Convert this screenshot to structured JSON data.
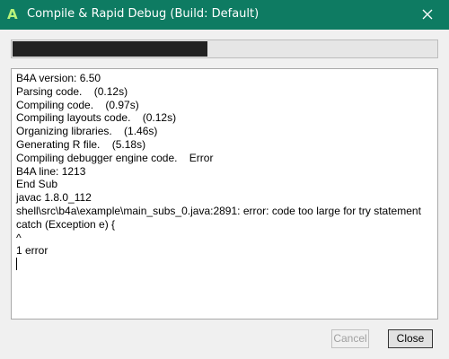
{
  "window": {
    "title": "Compile & Rapid Debug (Build: Default)",
    "app_icon_letter": "A",
    "titlebar_color": "#0e7b62",
    "app_icon_color": "#b9f27a"
  },
  "progress": {
    "fraction": 0.46
  },
  "log": {
    "lines": [
      "B4A version: 6.50",
      "Parsing code.    (0.12s)",
      "Compiling code.    (0.97s)",
      "Compiling layouts code.    (0.12s)",
      "Organizing libraries.    (1.46s)",
      "Generating R file.    (5.18s)",
      "Compiling debugger engine code.    Error",
      "B4A line: 1213",
      "End Sub",
      "javac 1.8.0_112",
      "shell\\src\\b4a\\example\\main_subs_0.java:2891: error: code too large for try statement",
      "catch (Exception e) {",
      "^",
      "1 error"
    ]
  },
  "buttons": {
    "cancel_label": "Cancel",
    "close_label": "Close"
  }
}
